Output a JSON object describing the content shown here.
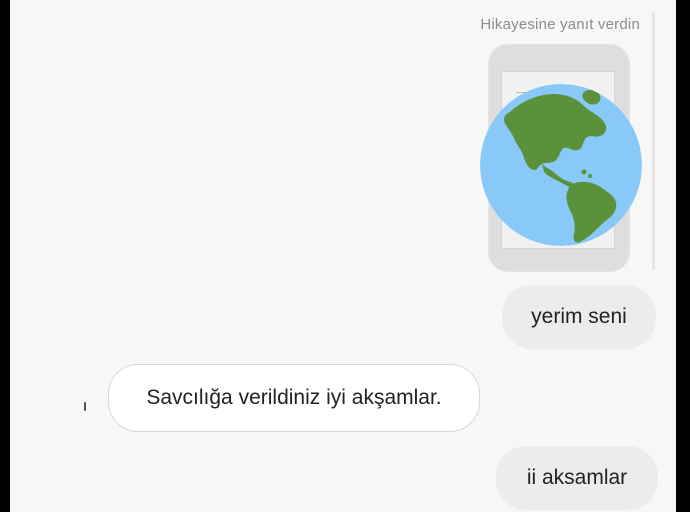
{
  "header": {
    "reply_note": "Hikayesine yanıt verdin"
  },
  "story": {
    "thumbnail_icon": "globe-americas-icon"
  },
  "messages": [
    {
      "direction": "outgoing",
      "text": "yerim seni"
    },
    {
      "direction": "incoming",
      "text": "Savcılığa verildiniz iyi akşamlar."
    },
    {
      "direction": "outgoing",
      "text": "ii aksamlar"
    }
  ],
  "colors": {
    "outgoing_bubble": "#ececec",
    "incoming_bubble": "#ffffff",
    "background": "#f7f7f7",
    "globe_ocean": "#88c9f9",
    "globe_land": "#5c913b"
  }
}
